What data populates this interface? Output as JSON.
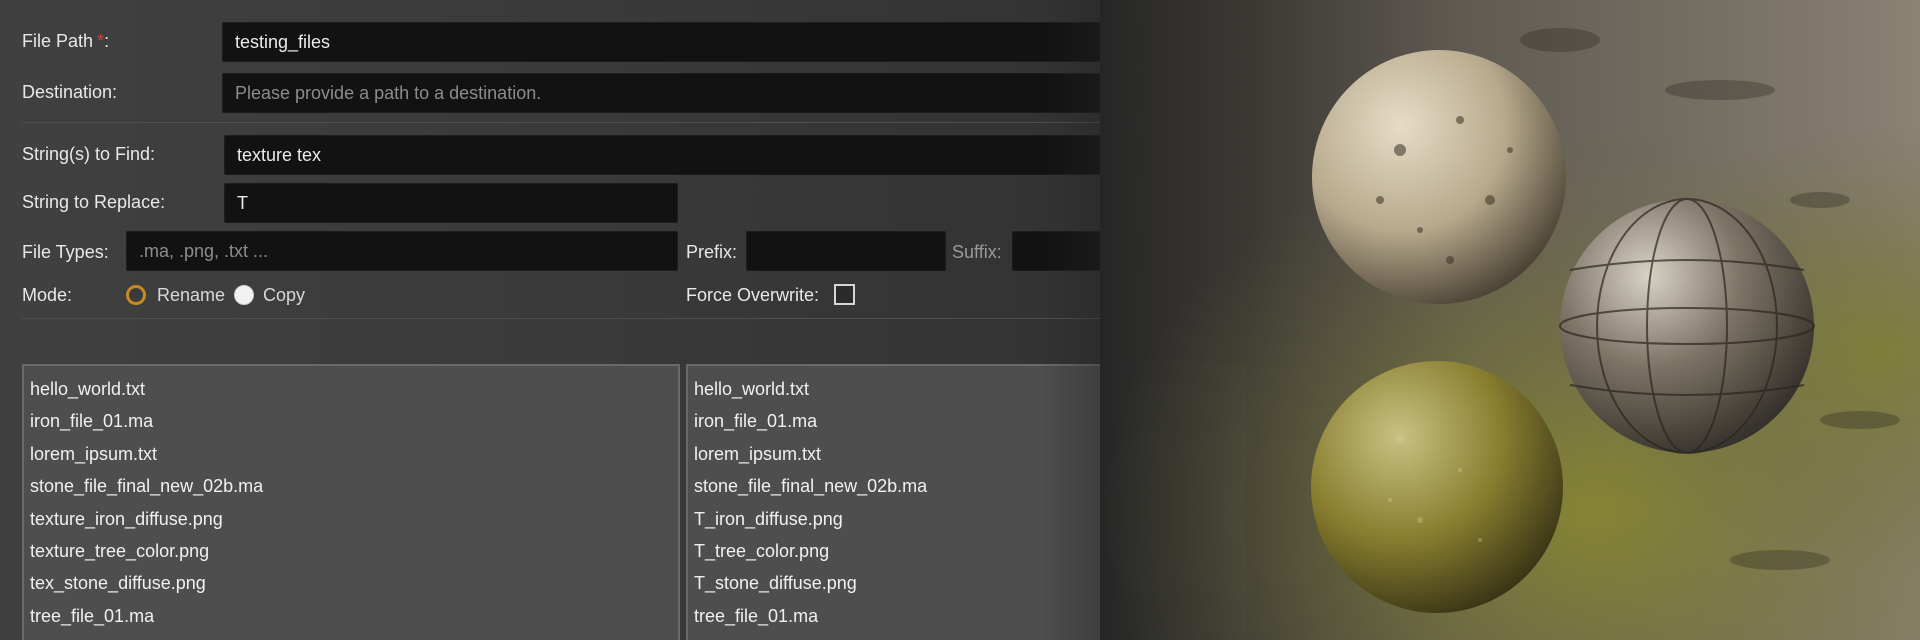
{
  "form": {
    "file_path_label": "File Path",
    "file_path_required": "*",
    "file_path_colon": ":",
    "file_path_value": "testing_files",
    "destination_label": "Destination:",
    "destination_placeholder": "Please provide a path to a destination.",
    "find_label": "String(s) to Find:",
    "find_value": "texture tex",
    "replace_label": "String to Replace:",
    "replace_value": "T",
    "file_types_label": "File Types:",
    "file_types_placeholder": ".ma, .png, .txt ...",
    "prefix_label": "Prefix:",
    "prefix_value": "",
    "suffix_label": "Suffix:",
    "suffix_value": "",
    "mode_label": "Mode:",
    "mode_options": [
      {
        "label": "Rename",
        "selected": true
      },
      {
        "label": "Copy",
        "selected": false
      }
    ],
    "force_overwrite_label": "Force Overwrite:",
    "force_overwrite_checked": false
  },
  "source_files": [
    "hello_world.txt",
    "iron_file_01.ma",
    "lorem_ipsum.txt",
    "stone_file_final_new_02b.ma",
    "texture_iron_diffuse.png",
    "texture_tree_color.png",
    "tex_stone_diffuse.png",
    "tree_file_01.ma"
  ],
  "preview_files": [
    "hello_world.txt",
    "iron_file_01.ma",
    "lorem_ipsum.txt",
    "stone_file_final_new_02b.ma",
    "T_iron_diffuse.png",
    "T_tree_color.png",
    "T_stone_diffuse.png",
    "tree_file_01.ma"
  ],
  "colors": {
    "accent_radio": "#c58a22",
    "required_marker": "#d83a3a",
    "field_bg": "#121212",
    "list_bg": "#4e4e4e"
  }
}
